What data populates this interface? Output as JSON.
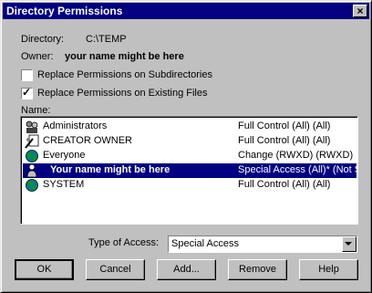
{
  "title": "Directory Permissions",
  "directory": {
    "label": "Directory:",
    "value": "C:\\TEMP"
  },
  "owner": {
    "label": "Owner:",
    "value": "your name might be here"
  },
  "options": {
    "replace_subdirs": {
      "label": "Replace Permissions on Subdirectories",
      "checked": false
    },
    "replace_files": {
      "label": "Replace Permissions on Existing Files",
      "checked": true
    }
  },
  "names_label": "Name:",
  "entries": [
    {
      "name": "Administrators",
      "access": "Full Control (All) (All)",
      "icon": "group-icon"
    },
    {
      "name": "CREATOR OWNER",
      "access": "Full Control (All) (All)",
      "icon": "creator-owner-icon"
    },
    {
      "name": "Everyone",
      "access": "Change (RWXD) (RWXD)",
      "icon": "globe-icon"
    },
    {
      "name": "Your name might be here",
      "access": "Special Access (All)* (Not S",
      "icon": "user-icon",
      "selected": true
    },
    {
      "name": "SYSTEM",
      "access": "Full Control (All) (All)",
      "icon": "system-icon"
    }
  ],
  "type_of_access": {
    "label": "Type of Access:",
    "value": "Special Access"
  },
  "buttons": {
    "ok": "OK",
    "cancel": "Cancel",
    "add": "Add...",
    "remove": "Remove",
    "help": "Help"
  },
  "colors": {
    "title_bg": "#000080",
    "face": "#c0c0c0",
    "selection": "#000080"
  }
}
